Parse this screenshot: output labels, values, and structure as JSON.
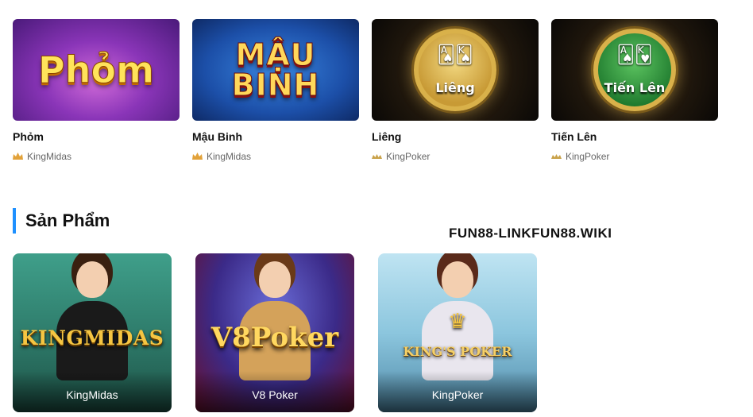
{
  "games": [
    {
      "name": "Phỏm",
      "provider": "KingMidas",
      "logo_text": "Phỏm",
      "provider_icon": "crown-icon"
    },
    {
      "name": "Mậu Binh",
      "provider": "KingMidas",
      "logo_text": "MẬU BINH",
      "provider_icon": "crown-icon"
    },
    {
      "name": "Liêng",
      "provider": "KingPoker",
      "logo_text": "Liêng",
      "provider_icon": "kingpoker-logo-icon"
    },
    {
      "name": "Tiến Lên",
      "provider": "KingPoker",
      "logo_text": "Tiến Lên",
      "provider_icon": "kingpoker-logo-icon"
    }
  ],
  "section": {
    "title": "Sản Phẩm"
  },
  "watermark": "FUN88-LINKFUN88.WIKI",
  "products": [
    {
      "label": "KingMidas",
      "logo_text": "KINGMIDAS"
    },
    {
      "label": "V8 Poker",
      "logo_text": "V8Poker"
    },
    {
      "label": "KingPoker",
      "logo_text": "KING'S POKER"
    }
  ],
  "colors": {
    "accent": "#1e90ff",
    "text": "#111111",
    "muted": "#666666"
  }
}
